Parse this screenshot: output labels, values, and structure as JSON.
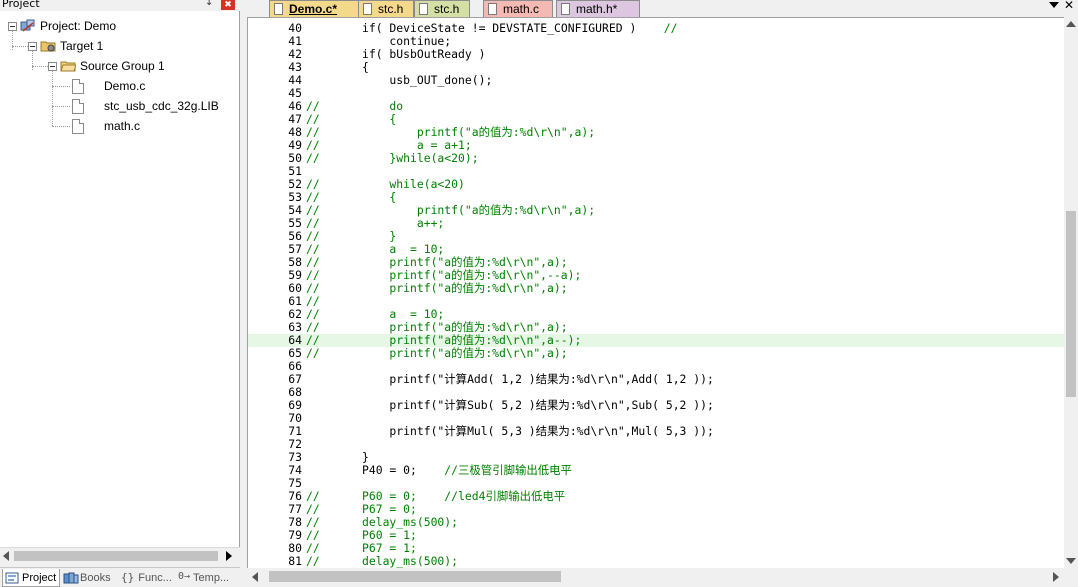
{
  "project_panel": {
    "title": "Project",
    "pin_glyph": "↧",
    "close_glyph": "✖",
    "tree": [
      {
        "label": "Project: Demo",
        "icon": "project-icon"
      },
      {
        "label": "Target 1",
        "icon": "target-folder-icon"
      },
      {
        "label": "Source Group 1",
        "icon": "folder-icon"
      },
      {
        "label": "Demo.c",
        "icon": "file-icon"
      },
      {
        "label": "stc_usb_cdc_32g.LIB",
        "icon": "file-icon"
      },
      {
        "label": "math.c",
        "icon": "file-icon"
      }
    ],
    "tabs": [
      {
        "label": "Project",
        "icon": "project-tab-icon",
        "glyph": ""
      },
      {
        "label": "Books",
        "icon": "books-icon",
        "glyph": ""
      },
      {
        "label": "Func...",
        "icon": "functions-icon",
        "glyph": "{}"
      },
      {
        "label": "Temp...",
        "icon": "templates-icon",
        "glyph": "0→"
      }
    ]
  },
  "editor": {
    "tabs": [
      {
        "label": "Demo.c*",
        "color": "#f5d98b",
        "active": true
      },
      {
        "label": "stc.h",
        "color": "#f5d98b",
        "active": false
      },
      {
        "label": "stc.h",
        "color": "#d4dfa6",
        "active": false
      },
      {
        "label": "math.c",
        "color": "#f4b9b2",
        "active": false
      },
      {
        "label": "math.h*",
        "color": "#dcc6e0",
        "active": false
      }
    ],
    "close_glyph": "✕",
    "highlight_color": "#e6f7e6",
    "code_lines": [
      {
        "n": "40",
        "cm": "",
        "code": "if( DeviceState != DEVSTATE_CONFIGURED )",
        "tail": "    //"
      },
      {
        "n": "41",
        "cm": "",
        "code": "    continue;",
        "tail": ""
      },
      {
        "n": "42",
        "cm": "",
        "code": "if( bUsbOutReady )",
        "tail": ""
      },
      {
        "n": "43",
        "cm": "",
        "code": "{",
        "tail": ""
      },
      {
        "n": "44",
        "cm": "",
        "code": "    usb_OUT_done();",
        "tail": ""
      },
      {
        "n": "45",
        "cm": "",
        "code": "",
        "tail": ""
      },
      {
        "n": "46",
        "cm": "//",
        "code": "    do",
        "tail": ""
      },
      {
        "n": "47",
        "cm": "//",
        "code": "    {",
        "tail": ""
      },
      {
        "n": "48",
        "cm": "//",
        "code": "        printf(\"a的值为:%d\\r\\n\",a);",
        "tail": ""
      },
      {
        "n": "49",
        "cm": "//",
        "code": "        a = a+1;",
        "tail": ""
      },
      {
        "n": "50",
        "cm": "//",
        "code": "    }while(a<20);",
        "tail": ""
      },
      {
        "n": "51",
        "cm": "",
        "code": "",
        "tail": ""
      },
      {
        "n": "52",
        "cm": "//",
        "code": "    while(a<20)",
        "tail": ""
      },
      {
        "n": "53",
        "cm": "//",
        "code": "    {",
        "tail": ""
      },
      {
        "n": "54",
        "cm": "//",
        "code": "        printf(\"a的值为:%d\\r\\n\",a);",
        "tail": ""
      },
      {
        "n": "55",
        "cm": "//",
        "code": "        a++;",
        "tail": ""
      },
      {
        "n": "56",
        "cm": "//",
        "code": "    }",
        "tail": ""
      },
      {
        "n": "57",
        "cm": "//",
        "code": "    a  = 10;",
        "tail": ""
      },
      {
        "n": "58",
        "cm": "//",
        "code": "    printf(\"a的值为:%d\\r\\n\",a);",
        "tail": ""
      },
      {
        "n": "59",
        "cm": "//",
        "code": "    printf(\"a的值为:%d\\r\\n\",--a);",
        "tail": ""
      },
      {
        "n": "60",
        "cm": "//",
        "code": "    printf(\"a的值为:%d\\r\\n\",a);",
        "tail": ""
      },
      {
        "n": "61",
        "cm": "//",
        "code": "",
        "tail": ""
      },
      {
        "n": "62",
        "cm": "//",
        "code": "    a  = 10;",
        "tail": ""
      },
      {
        "n": "63",
        "cm": "//",
        "code": "    printf(\"a的值为:%d\\r\\n\",a);",
        "tail": ""
      },
      {
        "n": "64",
        "cm": "//",
        "code": "    printf(\"a的值为:%d\\r\\n\",a--);",
        "tail": ""
      },
      {
        "n": "65",
        "cm": "//",
        "code": "    printf(\"a的值为:%d\\r\\n\",a);",
        "tail": ""
      },
      {
        "n": "66",
        "cm": "",
        "code": "",
        "tail": ""
      },
      {
        "n": "67",
        "cm": "",
        "code": "    printf(\"计算Add( 1,2 )结果为:%d\\r\\n\",Add( 1,2 ));",
        "tail": ""
      },
      {
        "n": "68",
        "cm": "",
        "code": "",
        "tail": ""
      },
      {
        "n": "69",
        "cm": "",
        "code": "    printf(\"计算Sub( 5,2 )结果为:%d\\r\\n\",Sub( 5,2 ));",
        "tail": ""
      },
      {
        "n": "70",
        "cm": "",
        "code": "",
        "tail": ""
      },
      {
        "n": "71",
        "cm": "",
        "code": "    printf(\"计算Mul( 5,3 )结果为:%d\\r\\n\",Mul( 5,3 ));",
        "tail": ""
      },
      {
        "n": "72",
        "cm": "",
        "code": "",
        "tail": ""
      },
      {
        "n": "73",
        "cm": "",
        "code": "}",
        "tail": ""
      },
      {
        "n": "74",
        "cm": "",
        "code": "P40 = 0;",
        "tail": "    //三极管引脚输出低电平"
      },
      {
        "n": "75",
        "cm": "",
        "code": "",
        "tail": ""
      },
      {
        "n": "76",
        "cm": "//",
        "code": "P60 = 0;    //led4引脚输出低电平",
        "tail": ""
      },
      {
        "n": "77",
        "cm": "//",
        "code": "P67 = 0;",
        "tail": ""
      },
      {
        "n": "78",
        "cm": "//",
        "code": "delay_ms(500);",
        "tail": ""
      },
      {
        "n": "79",
        "cm": "//",
        "code": "P60 = 1;",
        "tail": ""
      },
      {
        "n": "80",
        "cm": "//",
        "code": "P67 = 1;",
        "tail": ""
      },
      {
        "n": "81",
        "cm": "//",
        "code": "delay_ms(500);",
        "tail": ""
      }
    ],
    "highlighted_line": "64"
  }
}
